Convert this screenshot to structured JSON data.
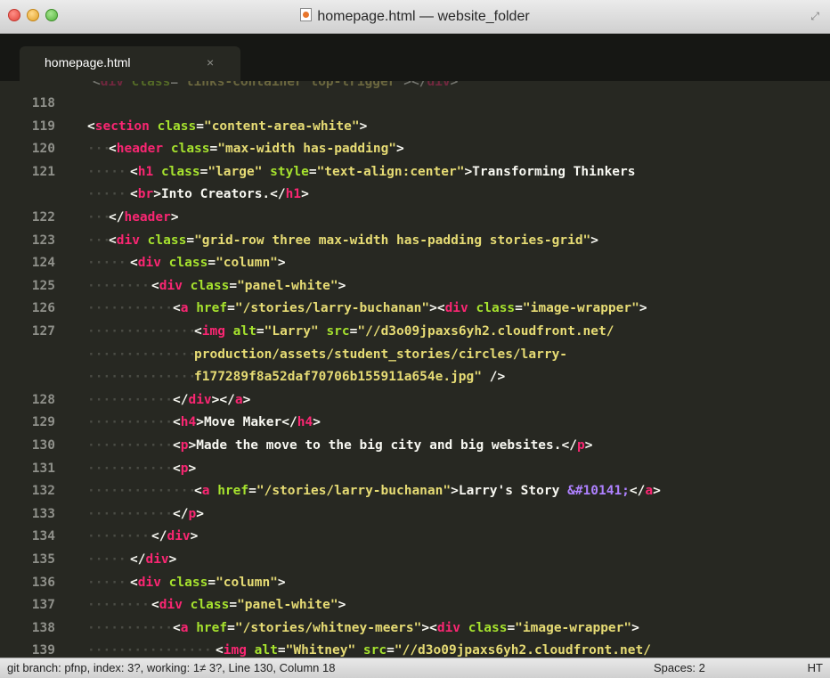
{
  "window": {
    "title": "homepage.html — website_folder"
  },
  "tabs": [
    {
      "label": "homepage.html",
      "close": "×"
    }
  ],
  "editor": {
    "top_partial_line": [
      {
        "t": "pun",
        "v": "<"
      },
      {
        "t": "tag",
        "v": "div"
      },
      {
        "t": "pun",
        "v": " "
      },
      {
        "t": "att",
        "v": "class"
      },
      {
        "t": "pun",
        "v": "="
      },
      {
        "t": "str",
        "v": "\"links-container top-trigger\""
      },
      {
        "t": "pun",
        "v": "></"
      },
      {
        "t": "tag",
        "v": "div"
      },
      {
        "t": "pun",
        "v": ">"
      }
    ],
    "lines": [
      {
        "num": "118",
        "indent": 0,
        "tokens": []
      },
      {
        "num": "119",
        "indent": 0,
        "tokens": [
          {
            "t": "pun",
            "v": "<"
          },
          {
            "t": "tag",
            "v": "section"
          },
          {
            "t": "pun",
            "v": " "
          },
          {
            "t": "att",
            "v": "class"
          },
          {
            "t": "pun",
            "v": "="
          },
          {
            "t": "str",
            "v": "\"content-area-white\""
          },
          {
            "t": "pun",
            "v": ">"
          }
        ]
      },
      {
        "num": "120",
        "indent": 1,
        "tokens": [
          {
            "t": "pun",
            "v": "<"
          },
          {
            "t": "tag",
            "v": "header"
          },
          {
            "t": "pun",
            "v": " "
          },
          {
            "t": "att",
            "v": "class"
          },
          {
            "t": "pun",
            "v": "="
          },
          {
            "t": "str",
            "v": "\"max-width has-padding\""
          },
          {
            "t": "pun",
            "v": ">"
          }
        ]
      },
      {
        "num": "121",
        "indent": 2,
        "tokens": [
          {
            "t": "pun",
            "v": "<"
          },
          {
            "t": "tag",
            "v": "h1"
          },
          {
            "t": "pun",
            "v": " "
          },
          {
            "t": "att",
            "v": "class"
          },
          {
            "t": "pun",
            "v": "="
          },
          {
            "t": "str",
            "v": "\"large\""
          },
          {
            "t": "pun",
            "v": " "
          },
          {
            "t": "att",
            "v": "style"
          },
          {
            "t": "pun",
            "v": "="
          },
          {
            "t": "str",
            "v": "\"text-align:center\""
          },
          {
            "t": "pun",
            "v": ">"
          },
          {
            "t": "txt",
            "v": "Transforming Thinkers"
          }
        ]
      },
      {
        "num": "",
        "indent": 2,
        "tokens": [
          {
            "t": "pun",
            "v": "<"
          },
          {
            "t": "tag",
            "v": "br"
          },
          {
            "t": "pun",
            "v": ">"
          },
          {
            "t": "txt",
            "v": "Into Creators."
          },
          {
            "t": "pun",
            "v": "</"
          },
          {
            "t": "tag",
            "v": "h1"
          },
          {
            "t": "pun",
            "v": ">"
          }
        ]
      },
      {
        "num": "122",
        "indent": 1,
        "tokens": [
          {
            "t": "pun",
            "v": "</"
          },
          {
            "t": "tag",
            "v": "header"
          },
          {
            "t": "pun",
            "v": ">"
          }
        ]
      },
      {
        "num": "123",
        "indent": 1,
        "tokens": [
          {
            "t": "pun",
            "v": "<"
          },
          {
            "t": "tag",
            "v": "div"
          },
          {
            "t": "pun",
            "v": " "
          },
          {
            "t": "att",
            "v": "class"
          },
          {
            "t": "pun",
            "v": "="
          },
          {
            "t": "str",
            "v": "\"grid-row three max-width has-padding stories-grid\""
          },
          {
            "t": "pun",
            "v": ">"
          }
        ]
      },
      {
        "num": "124",
        "indent": 2,
        "tokens": [
          {
            "t": "pun",
            "v": "<"
          },
          {
            "t": "tag",
            "v": "div"
          },
          {
            "t": "pun",
            "v": " "
          },
          {
            "t": "att",
            "v": "class"
          },
          {
            "t": "pun",
            "v": "="
          },
          {
            "t": "str",
            "v": "\"column\""
          },
          {
            "t": "pun",
            "v": ">"
          }
        ]
      },
      {
        "num": "125",
        "indent": 3,
        "tokens": [
          {
            "t": "pun",
            "v": "<"
          },
          {
            "t": "tag",
            "v": "div"
          },
          {
            "t": "pun",
            "v": " "
          },
          {
            "t": "att",
            "v": "class"
          },
          {
            "t": "pun",
            "v": "="
          },
          {
            "t": "str",
            "v": "\"panel-white\""
          },
          {
            "t": "pun",
            "v": ">"
          }
        ]
      },
      {
        "num": "126",
        "indent": 4,
        "tokens": [
          {
            "t": "pun",
            "v": "<"
          },
          {
            "t": "tag",
            "v": "a"
          },
          {
            "t": "pun",
            "v": " "
          },
          {
            "t": "att",
            "v": "href"
          },
          {
            "t": "pun",
            "v": "="
          },
          {
            "t": "str",
            "v": "\"/stories/larry-buchanan\""
          },
          {
            "t": "pun",
            "v": "><"
          },
          {
            "t": "tag",
            "v": "div"
          },
          {
            "t": "pun",
            "v": " "
          },
          {
            "t": "att",
            "v": "class"
          },
          {
            "t": "pun",
            "v": "="
          },
          {
            "t": "str",
            "v": "\"image-wrapper\""
          },
          {
            "t": "pun",
            "v": ">"
          }
        ]
      },
      {
        "num": "127",
        "indent": 5,
        "tokens": [
          {
            "t": "pun",
            "v": "<"
          },
          {
            "t": "tag",
            "v": "img"
          },
          {
            "t": "pun",
            "v": " "
          },
          {
            "t": "att",
            "v": "alt"
          },
          {
            "t": "pun",
            "v": "="
          },
          {
            "t": "str",
            "v": "\"Larry\""
          },
          {
            "t": "pun",
            "v": " "
          },
          {
            "t": "att",
            "v": "src"
          },
          {
            "t": "pun",
            "v": "="
          },
          {
            "t": "str",
            "v": "\"//d3o09jpaxs6yh2.cloudfront.net/"
          }
        ]
      },
      {
        "num": "",
        "indent": 5,
        "tokens": [
          {
            "t": "str",
            "v": "production/assets/student_stories/circles/larry-"
          }
        ]
      },
      {
        "num": "",
        "indent": 5,
        "tokens": [
          {
            "t": "str",
            "v": "f177289f8a52daf70706b155911a654e.jpg\""
          },
          {
            "t": "pun",
            "v": " />"
          }
        ]
      },
      {
        "num": "128",
        "indent": 4,
        "tokens": [
          {
            "t": "pun",
            "v": "</"
          },
          {
            "t": "tag",
            "v": "div"
          },
          {
            "t": "pun",
            "v": "></"
          },
          {
            "t": "tag",
            "v": "a"
          },
          {
            "t": "pun",
            "v": ">"
          }
        ]
      },
      {
        "num": "129",
        "indent": 4,
        "tokens": [
          {
            "t": "pun",
            "v": "<"
          },
          {
            "t": "tag",
            "v": "h4"
          },
          {
            "t": "pun",
            "v": ">"
          },
          {
            "t": "txt",
            "v": "Move Maker"
          },
          {
            "t": "pun",
            "v": "</"
          },
          {
            "t": "tag",
            "v": "h4"
          },
          {
            "t": "pun",
            "v": ">"
          }
        ]
      },
      {
        "num": "130",
        "indent": 4,
        "tokens": [
          {
            "t": "pun",
            "v": "<"
          },
          {
            "t": "tag",
            "v": "p"
          },
          {
            "t": "pun",
            "v": ">"
          },
          {
            "t": "txt",
            "v": "Made the move to the big city and big websites."
          },
          {
            "t": "pun",
            "v": "</"
          },
          {
            "t": "tag",
            "v": "p"
          },
          {
            "t": "pun",
            "v": ">"
          }
        ]
      },
      {
        "num": "131",
        "indent": 4,
        "tokens": [
          {
            "t": "pun",
            "v": "<"
          },
          {
            "t": "tag",
            "v": "p"
          },
          {
            "t": "pun",
            "v": ">"
          }
        ]
      },
      {
        "num": "132",
        "indent": 5,
        "tokens": [
          {
            "t": "pun",
            "v": "<"
          },
          {
            "t": "tag",
            "v": "a"
          },
          {
            "t": "pun",
            "v": " "
          },
          {
            "t": "att",
            "v": "href"
          },
          {
            "t": "pun",
            "v": "="
          },
          {
            "t": "str",
            "v": "\"/stories/larry-buchanan\""
          },
          {
            "t": "pun",
            "v": ">"
          },
          {
            "t": "txt",
            "v": "Larry's Story "
          },
          {
            "t": "ent",
            "v": "&#10141;"
          },
          {
            "t": "pun",
            "v": "</"
          },
          {
            "t": "tag",
            "v": "a"
          },
          {
            "t": "pun",
            "v": ">"
          }
        ]
      },
      {
        "num": "133",
        "indent": 4,
        "tokens": [
          {
            "t": "pun",
            "v": "</"
          },
          {
            "t": "tag",
            "v": "p"
          },
          {
            "t": "pun",
            "v": ">"
          }
        ]
      },
      {
        "num": "134",
        "indent": 3,
        "tokens": [
          {
            "t": "pun",
            "v": "</"
          },
          {
            "t": "tag",
            "v": "div"
          },
          {
            "t": "pun",
            "v": ">"
          }
        ]
      },
      {
        "num": "135",
        "indent": 2,
        "tokens": [
          {
            "t": "pun",
            "v": "</"
          },
          {
            "t": "tag",
            "v": "div"
          },
          {
            "t": "pun",
            "v": ">"
          }
        ]
      },
      {
        "num": "136",
        "indent": 2,
        "tokens": [
          {
            "t": "pun",
            "v": "<"
          },
          {
            "t": "tag",
            "v": "div"
          },
          {
            "t": "pun",
            "v": " "
          },
          {
            "t": "att",
            "v": "class"
          },
          {
            "t": "pun",
            "v": "="
          },
          {
            "t": "str",
            "v": "\"column\""
          },
          {
            "t": "pun",
            "v": ">"
          }
        ]
      },
      {
        "num": "137",
        "indent": 3,
        "tokens": [
          {
            "t": "pun",
            "v": "<"
          },
          {
            "t": "tag",
            "v": "div"
          },
          {
            "t": "pun",
            "v": " "
          },
          {
            "t": "att",
            "v": "class"
          },
          {
            "t": "pun",
            "v": "="
          },
          {
            "t": "str",
            "v": "\"panel-white\""
          },
          {
            "t": "pun",
            "v": ">"
          }
        ]
      },
      {
        "num": "138",
        "indent": 4,
        "tokens": [
          {
            "t": "pun",
            "v": "<"
          },
          {
            "t": "tag",
            "v": "a"
          },
          {
            "t": "pun",
            "v": " "
          },
          {
            "t": "att",
            "v": "href"
          },
          {
            "t": "pun",
            "v": "="
          },
          {
            "t": "str",
            "v": "\"/stories/whitney-meers\""
          },
          {
            "t": "pun",
            "v": "><"
          },
          {
            "t": "tag",
            "v": "div"
          },
          {
            "t": "pun",
            "v": " "
          },
          {
            "t": "att",
            "v": "class"
          },
          {
            "t": "pun",
            "v": "="
          },
          {
            "t": "str",
            "v": "\"image-wrapper\""
          },
          {
            "t": "pun",
            "v": ">"
          }
        ]
      },
      {
        "num": "139",
        "indent": 6,
        "tokens": [
          {
            "t": "pun",
            "v": "<"
          },
          {
            "t": "tag",
            "v": "img"
          },
          {
            "t": "pun",
            "v": " "
          },
          {
            "t": "att",
            "v": "alt"
          },
          {
            "t": "pun",
            "v": "="
          },
          {
            "t": "str",
            "v": "\"Whitney\""
          },
          {
            "t": "pun",
            "v": " "
          },
          {
            "t": "att",
            "v": "src"
          },
          {
            "t": "pun",
            "v": "="
          },
          {
            "t": "str",
            "v": "\"//d3o09jpaxs6yh2.cloudfront.net/"
          }
        ]
      }
    ]
  },
  "statusbar": {
    "git": "git branch: pfnp, index: 3?, working: 1≠ 3?, Line 130, Column 18",
    "spaces": "Spaces: 2",
    "syntax": "HT"
  },
  "colors": {
    "background": "#272822",
    "tag": "#f92672",
    "attribute": "#a6e22e",
    "string": "#e6db74",
    "text": "#f8f8f2",
    "entity": "#ae81ff",
    "gutter": "#8f908a"
  }
}
